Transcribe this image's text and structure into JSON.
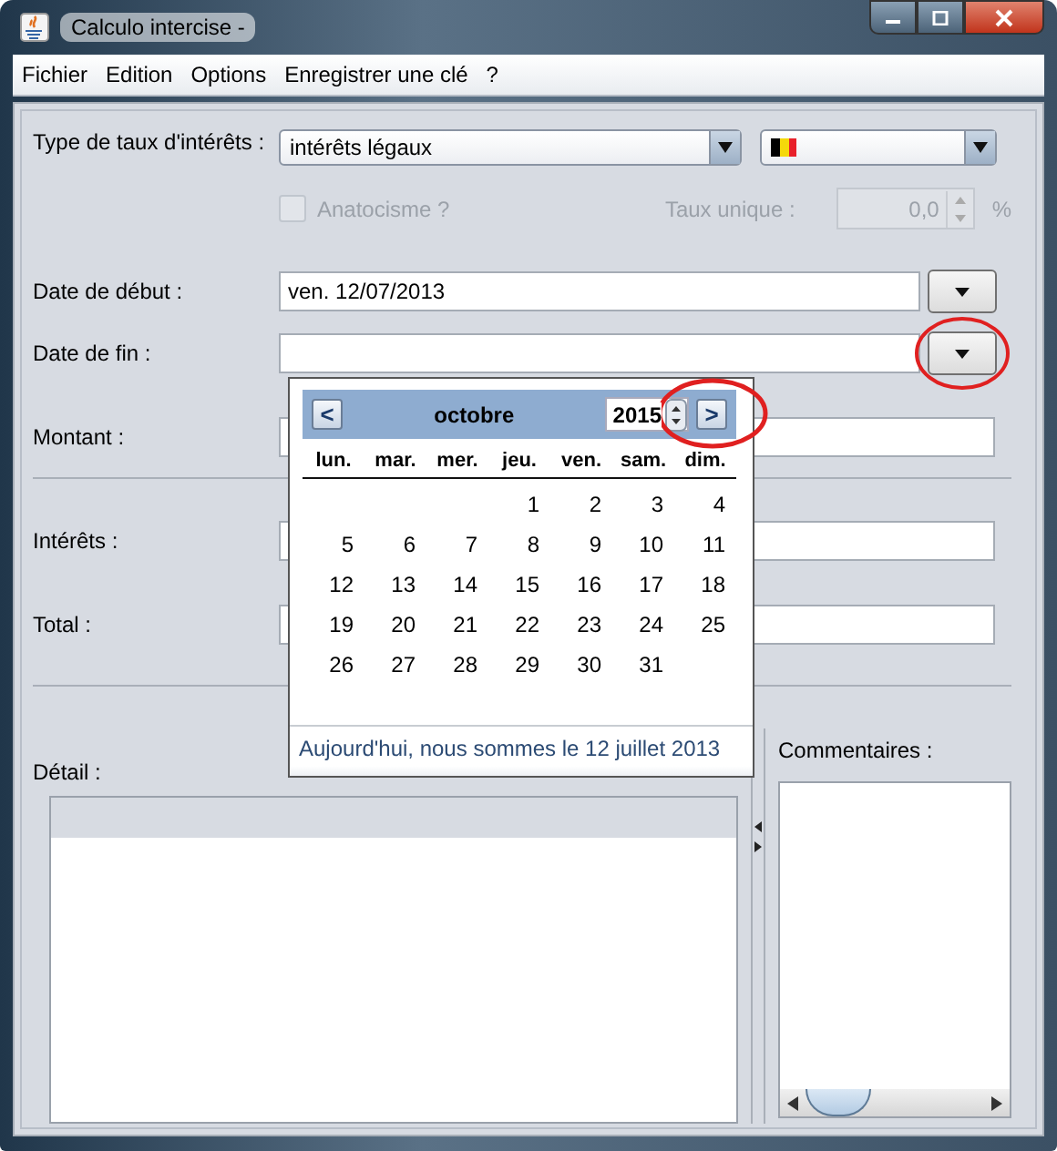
{
  "window": {
    "title": "Calculo intercise -"
  },
  "menu": [
    "Fichier",
    "Edition",
    "Options",
    "Enregistrer une clé",
    "?"
  ],
  "rate_type": {
    "label": "Type de taux d'intérêts :",
    "value": "intérêts légaux"
  },
  "anatocisme": {
    "label": "Anatocisme ?",
    "checked": false,
    "disabled": true
  },
  "taux_unique": {
    "label": "Taux unique :",
    "value": "0,0",
    "unit": "%",
    "disabled": true
  },
  "date_debut": {
    "label": "Date de début :",
    "value": "ven. 12/07/2013",
    "highlighted": false
  },
  "date_fin": {
    "label": "Date de fin :",
    "highlighted": true
  },
  "montant": {
    "label": "Montant :"
  },
  "interets": {
    "label": "Intérêts :"
  },
  "total": {
    "label": "Total :"
  },
  "detail": {
    "label": "Détail :"
  },
  "commentaires": {
    "label": "Commentaires :"
  },
  "calendar": {
    "month": "octobre",
    "year": "2015",
    "year_highlighted": true,
    "weekdays": [
      "lun.",
      "mar.",
      "mer.",
      "jeu.",
      "ven.",
      "sam.",
      "dim."
    ],
    "weeks": [
      [
        "1",
        "2",
        "3",
        "4"
      ],
      [
        "5",
        "6",
        "7",
        "8",
        "9",
        "10",
        "11"
      ],
      [
        "12",
        "13",
        "14",
        "15",
        "16",
        "17",
        "18"
      ],
      [
        "19",
        "20",
        "21",
        "22",
        "23",
        "24",
        "25"
      ],
      [
        "26",
        "27",
        "28",
        "29",
        "30",
        "31"
      ]
    ],
    "prev": "<",
    "next": ">",
    "today": "Aujourd'hui, nous sommes le  12 juillet 2013"
  }
}
